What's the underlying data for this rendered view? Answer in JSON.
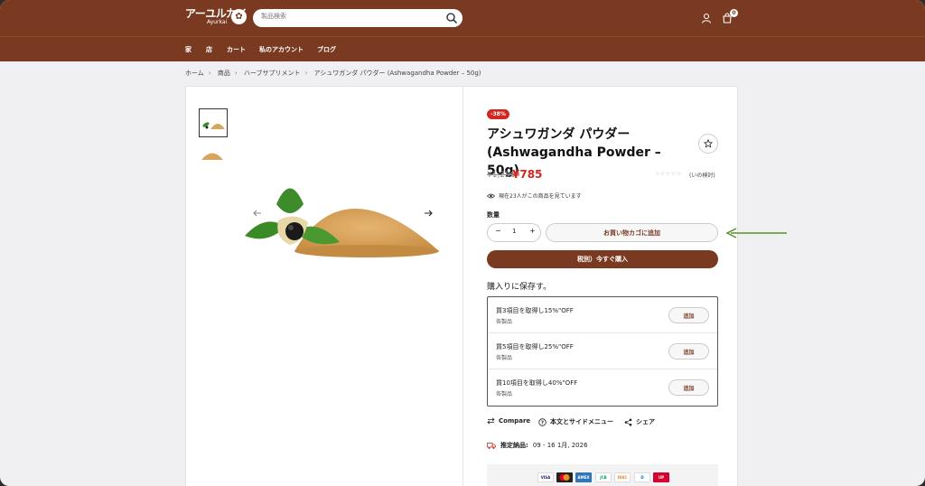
{
  "header": {
    "logo_jp": "アーユルカイ",
    "logo_en": "Ayurkai",
    "search_placeholder": "製品検索",
    "cart_count": "0",
    "accent": "#7a3a22"
  },
  "nav": [
    "家",
    "店",
    "カート",
    "私のアカウント",
    "ブログ"
  ],
  "breadcrumb": [
    "ホーム",
    "商品",
    "ハーブサプリメント",
    "アシュワガンダ パウダー (Ashwagandha Powder – 50g)"
  ],
  "product": {
    "badge": "-38%",
    "title_line1": "アシュワガンダ パウダー",
    "title_line2": "(Ashwagandha Powder – 50g)",
    "old_price": "¥1,256",
    "new_price": "¥785",
    "stars": "☆☆☆☆☆",
    "reviews": "(いの検討)",
    "viewers": "現在23人がこの商品を見ています",
    "qty_label": "数量",
    "qty_value": "1",
    "add_to_cart": "お買い物カゴに追加",
    "buy_now": "税別）今すぐ購入",
    "sale_color": "#d3261e"
  },
  "bundles": {
    "title": "購入りに保存す。",
    "items": [
      {
        "title": "買3項目を取得し15%\"OFF",
        "sub": "各製品",
        "button": "追加"
      },
      {
        "title": "買5項目を取得し25%\"OFF",
        "sub": "各製品",
        "button": "追加"
      },
      {
        "title": "買10項目を取得し40%\"OFF",
        "sub": "各製品",
        "button": "追加"
      }
    ]
  },
  "actions": {
    "compare": "Compare",
    "sidebar": "本文とサイドメニュー",
    "share": "シェア"
  },
  "delivery": {
    "label": "推定納品:",
    "value": "09 - 16 1月, 2026"
  },
  "payments": [
    "VISA",
    "MC",
    "AMEX",
    "JCB",
    "DISC",
    "D",
    "UP"
  ]
}
